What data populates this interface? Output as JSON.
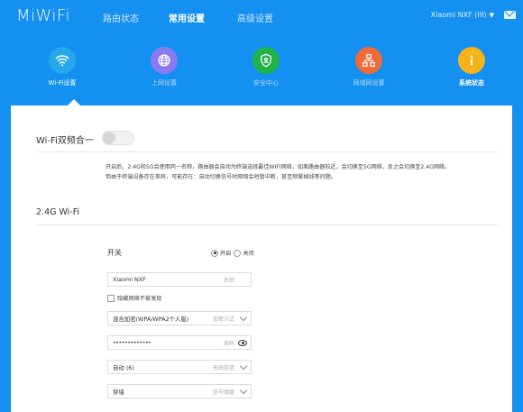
{
  "header": {
    "logo": "MiWiFi",
    "nav": [
      "路由状态",
      "常用设置",
      "高级设置"
    ],
    "active_nav": 1,
    "user": "Xiaomi NXF (III)"
  },
  "apps": [
    {
      "label": "Wi-Fi设置",
      "icon": "wifi-icon",
      "color": "#26a7e8"
    },
    {
      "label": "上网设置",
      "icon": "globe-icon",
      "color": "#8a7af0"
    },
    {
      "label": "安全中心",
      "icon": "shield-icon",
      "color": "#22b24a"
    },
    {
      "label": "局域网设置",
      "icon": "network-icon",
      "color": "#f06b37"
    },
    {
      "label": "系统状态",
      "icon": "info-icon",
      "color": "#f5b21b"
    }
  ],
  "dual_band": {
    "title": "Wi-Fi双频合一",
    "enabled": false,
    "description_line1": "开启后，2.4G和5G会使用同一名称，路由器会自动为终端选择最佳WIFI网络，如离路由器较近，会切换至5G网络，反之会切换至2.4G网络。",
    "description_line2": "但由于终端设备存在差异，可能存在：自动切换信号时网络会短暂中断，甚至频繁掉线等问题。"
  },
  "section_24g": {
    "title": "2.4G Wi-Fi",
    "switch_label": "开关",
    "radio_on": "开启",
    "radio_off": "关闭",
    "ssid_value": "Xiaomi NXF",
    "ssid_hint": "名称",
    "hide_label": "隐藏网络不被发现",
    "encryption_value": "混合加密(WPA/WPA2个人版)",
    "encryption_hint": "加密方式",
    "password_value": "•••••••••••••",
    "password_hint": "密码",
    "channel_value": "自动 (6)",
    "channel_hint": "无线信道",
    "strength_value": "穿墙",
    "strength_hint": "信号强度"
  }
}
